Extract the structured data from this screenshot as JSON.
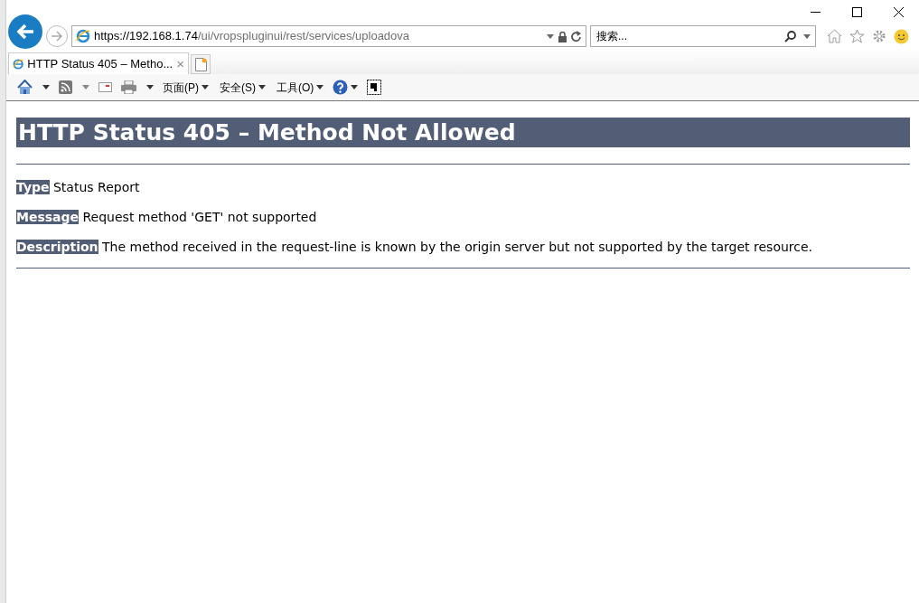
{
  "address_bar": {
    "host": "https://192.168.1.74",
    "path": "/ui/vropspluginui/rest/services/uploadova"
  },
  "search": {
    "placeholder": "搜索..."
  },
  "tabs": [
    {
      "title": "HTTP Status 405 – Metho...",
      "close": "×",
      "selected": true
    }
  ],
  "command_bar": {
    "menus": [
      {
        "label": "页面(P)"
      },
      {
        "label": "安全(S)"
      },
      {
        "label": "工具(O)"
      }
    ]
  },
  "page": {
    "heading": "HTTP Status 405 – Method Not Allowed",
    "fields": [
      {
        "label": "Type",
        "value": "Status Report"
      },
      {
        "label": "Message",
        "value": "Request method 'GET' not supported"
      },
      {
        "label": "Description",
        "value": "The method received in the request-line is known by the origin server but not supported by the target resource."
      }
    ]
  }
}
